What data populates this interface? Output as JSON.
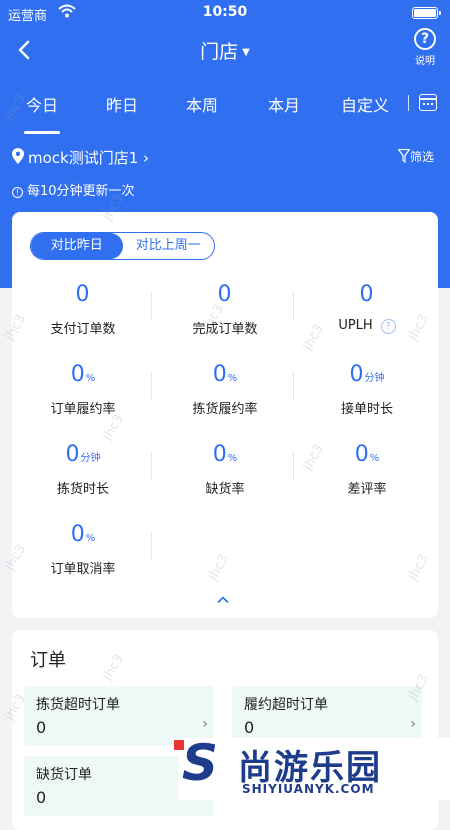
{
  "status_bar": {
    "carrier": "运营商",
    "time": "10:50"
  },
  "nav": {
    "title": "门店",
    "help_label": "说明"
  },
  "tabs": [
    {
      "label": "今日",
      "active": true
    },
    {
      "label": "昨日",
      "active": false
    },
    {
      "label": "本周",
      "active": false
    },
    {
      "label": "本月",
      "active": false
    },
    {
      "label": "自定义",
      "active": false
    }
  ],
  "store": {
    "name": "mock测试门店1",
    "filter_label": "筛选"
  },
  "update_notice": "每10分钟更新一次",
  "compare": {
    "options": [
      "对比昨日",
      "对比上周一"
    ],
    "selected": "对比昨日"
  },
  "metrics": [
    {
      "value": "0",
      "unit": "",
      "label": "支付订单数"
    },
    {
      "value": "0",
      "unit": "",
      "label": "完成订单数"
    },
    {
      "value": "0",
      "unit": "",
      "label": "UPLH",
      "has_help": true
    },
    {
      "value": "0",
      "unit": "%",
      "label": "订单履约率"
    },
    {
      "value": "0",
      "unit": "%",
      "label": "拣货履约率"
    },
    {
      "value": "0",
      "unit": "分钟",
      "label": "接单时长"
    },
    {
      "value": "0",
      "unit": "分钟",
      "label": "拣货时长"
    },
    {
      "value": "0",
      "unit": "%",
      "label": "缺货率"
    },
    {
      "value": "0",
      "unit": "%",
      "label": "差评率"
    },
    {
      "value": "0",
      "unit": "%",
      "label": "订单取消率"
    }
  ],
  "orders": {
    "title": "订单",
    "tiles": [
      {
        "label": "拣货超时订单",
        "value": "0"
      },
      {
        "label": "履约超时订单",
        "value": "0"
      },
      {
        "label": "缺货订单",
        "value": "0"
      }
    ]
  },
  "watermark": "jhc3",
  "brand": {
    "chinese": "尚游乐园",
    "english": "SHIYIUANYK.COM"
  },
  "colors": {
    "primary": "#2f6ff0",
    "tile_bg": "#eef8f6",
    "page_bg": "#f2f3f5"
  }
}
